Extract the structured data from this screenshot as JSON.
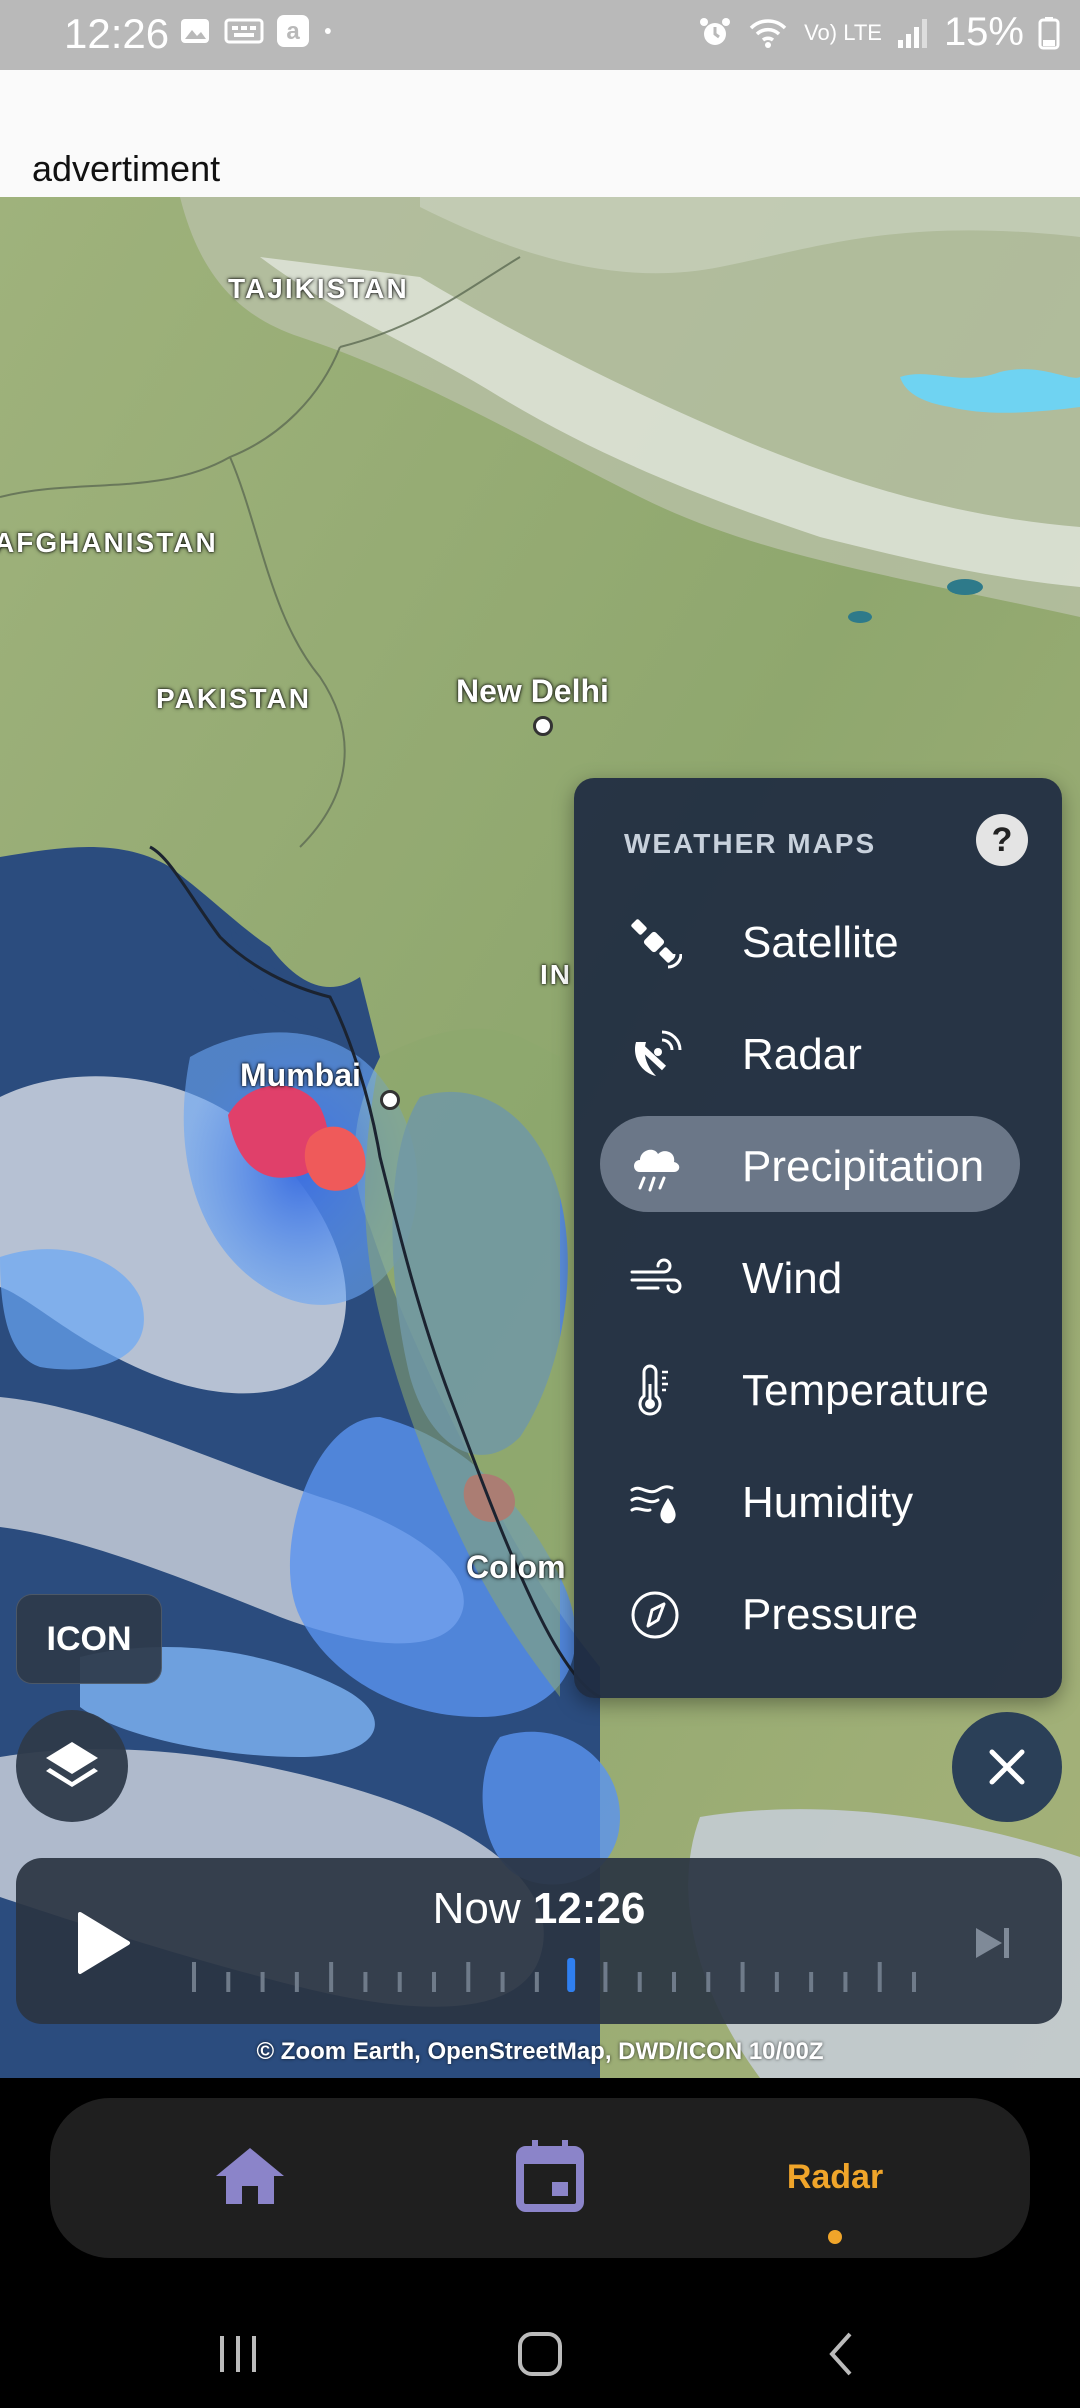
{
  "status_bar": {
    "time": "12:26",
    "battery": "15%",
    "left_icons": [
      "gallery-icon",
      "image-icon",
      "a-app-icon",
      "dot-icon"
    ],
    "right_icons": [
      "alarm-icon",
      "wifi-icon",
      "volte-icon",
      "signal-icon",
      "battery-icon"
    ],
    "volte_text": "Vo) LTE"
  },
  "ad": {
    "label": "advertiment"
  },
  "map": {
    "countries": [
      "TAJIKISTAN",
      "AFGHANISTAN",
      "PAKISTAN",
      "IN"
    ],
    "cities": [
      "New Delhi",
      "Mumbai",
      "Colom"
    ]
  },
  "weather_menu": {
    "title": "WEATHER MAPS",
    "help": "?",
    "selected": "Precipitation",
    "items": [
      {
        "label": "Satellite",
        "icon": "satellite-icon"
      },
      {
        "label": "Radar",
        "icon": "radar-dish-icon"
      },
      {
        "label": "Precipitation",
        "icon": "rain-cloud-icon"
      },
      {
        "label": "Wind",
        "icon": "wind-icon"
      },
      {
        "label": "Temperature",
        "icon": "thermometer-icon"
      },
      {
        "label": "Humidity",
        "icon": "humidity-icon"
      },
      {
        "label": "Pressure",
        "icon": "compass-gauge-icon"
      }
    ]
  },
  "model_button": {
    "label": "ICON"
  },
  "timeline": {
    "now_prefix": "Now",
    "now_time": "12:26",
    "position": 0.52
  },
  "attribution": "© Zoom Earth, OpenStreetMap, DWD/ICON 10/00Z",
  "bottom_nav": {
    "items": [
      {
        "name": "home",
        "icon": "home-icon"
      },
      {
        "name": "calendar",
        "icon": "calendar-icon"
      },
      {
        "name": "radar",
        "label": "Radar",
        "active": true
      }
    ],
    "accent": "#f0a52a",
    "icon_color": "#8b84c9"
  }
}
